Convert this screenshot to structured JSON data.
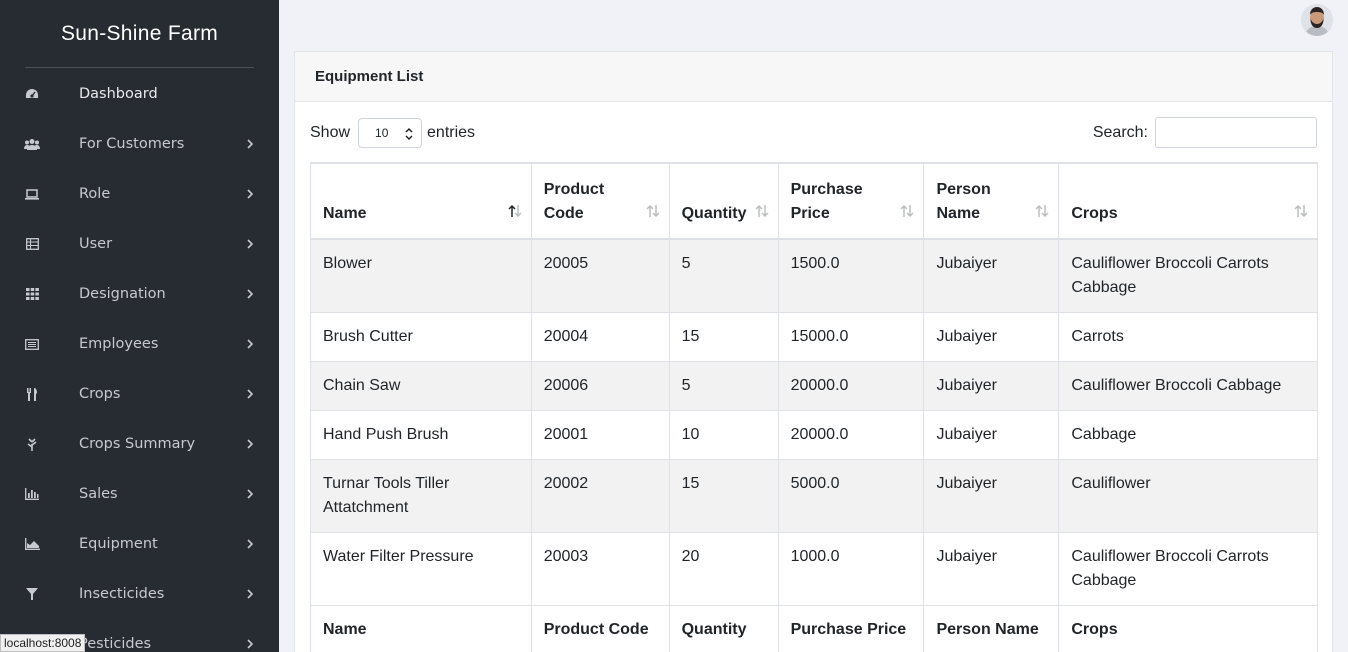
{
  "brand": "Sun-Shine Farm",
  "sidebar": {
    "items": [
      {
        "label": "Dashboard",
        "icon": "dashboard-icon",
        "submenu": false
      },
      {
        "label": "For Customers",
        "icon": "users-icon",
        "submenu": true
      },
      {
        "label": "Role",
        "icon": "laptop-icon",
        "submenu": true
      },
      {
        "label": "User",
        "icon": "table-icon",
        "submenu": true
      },
      {
        "label": "Designation",
        "icon": "grid-icon",
        "submenu": true
      },
      {
        "label": "Employees",
        "icon": "id-card-icon",
        "submenu": true
      },
      {
        "label": "Crops",
        "icon": "cutlery-icon",
        "submenu": true
      },
      {
        "label": "Crops Summary",
        "icon": "leaf-icon",
        "submenu": true
      },
      {
        "label": "Sales",
        "icon": "bar-chart-icon",
        "submenu": true
      },
      {
        "label": "Equipment",
        "icon": "area-chart-icon",
        "submenu": true
      },
      {
        "label": "Insecticides",
        "icon": "filter-icon",
        "submenu": true
      },
      {
        "label": "Pesticides",
        "icon": "flask-icon",
        "submenu": true
      }
    ]
  },
  "card": {
    "title": "Equipment List",
    "show_label": "Show",
    "entries_label": "entries",
    "page_length": "10",
    "search_label": "Search:",
    "search_value": ""
  },
  "table": {
    "headers": [
      "Name",
      "Product Code",
      "Quantity",
      "Purchase Price",
      "Person Name",
      "Crops"
    ],
    "rows": [
      [
        "Blower",
        "20005",
        "5",
        "1500.0",
        "Jubaiyer",
        "Cauliflower Broccoli Carrots Cabbage"
      ],
      [
        "Brush Cutter",
        "20004",
        "15",
        "15000.0",
        "Jubaiyer",
        "Carrots"
      ],
      [
        "Chain Saw",
        "20006",
        "5",
        "20000.0",
        "Jubaiyer",
        "Cauliflower Broccoli Cabbage"
      ],
      [
        "Hand Push Brush",
        "20001",
        "10",
        "20000.0",
        "Jubaiyer",
        "Cabbage"
      ],
      [
        "Turnar Tools Tiller Attatchment",
        "20002",
        "15",
        "5000.0",
        "Jubaiyer",
        "Cauliflower"
      ],
      [
        "Water Filter Pressure",
        "20003",
        "20",
        "1000.0",
        "Jubaiyer",
        "Cauliflower Broccoli Carrots Cabbage"
      ]
    ],
    "footer": [
      "Name",
      "Product Code",
      "Quantity",
      "Purchase Price",
      "Person Name",
      "Crops"
    ]
  },
  "status_tip": "localhost:8008",
  "colors": {
    "sidebar_bg": "#272c33",
    "page_bg": "#f1f2f7",
    "striped_row": "#f2f2f2"
  }
}
